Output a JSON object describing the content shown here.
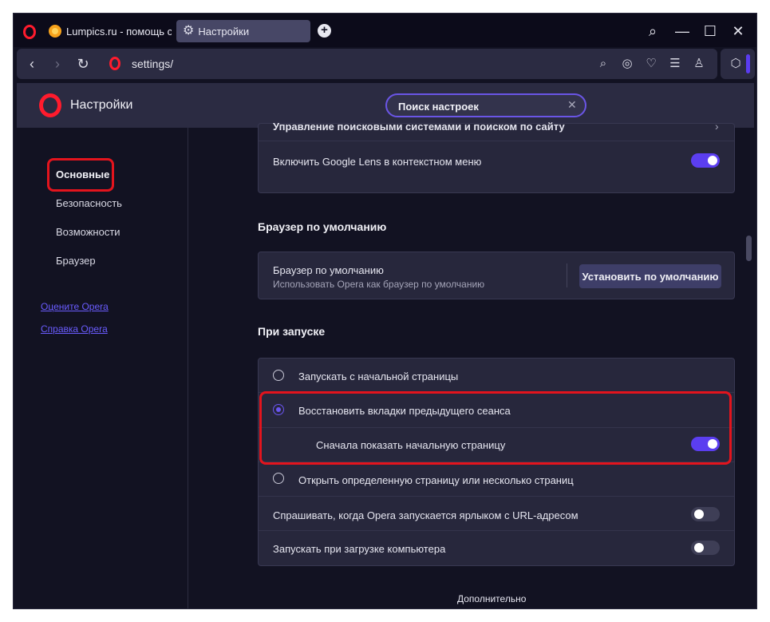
{
  "tabs": [
    {
      "label": "Lumpics.ru - помощь с ко"
    },
    {
      "label": "Настройки"
    }
  ],
  "window_controls": {
    "search": "⌕",
    "minimize": "—",
    "maximize": "☐",
    "close": "✕"
  },
  "address_bar": {
    "url": "settings/"
  },
  "settings_header": {
    "title": "Настройки",
    "search_value": "Поиск настроек"
  },
  "sidebar": {
    "items": [
      {
        "label": "Основные",
        "active": true
      },
      {
        "label": "Безопасность"
      },
      {
        "label": "Возможности"
      },
      {
        "label": "Браузер"
      }
    ],
    "links": [
      {
        "label": "Оцените Opera"
      },
      {
        "label": "Справка Opera"
      }
    ]
  },
  "search_engines": {
    "manage_label": "Управление поисковыми системами и поиском по сайту",
    "google_lens_label": "Включить Google Lens в контекстном меню",
    "google_lens_on": true
  },
  "default_browser": {
    "section_title": "Браузер по умолчанию",
    "row_title": "Браузер по умолчанию",
    "row_subtitle": "Использовать Opera как браузер по умолчанию",
    "button_label": "Установить по умолчанию"
  },
  "startup": {
    "section_title": "При запуске",
    "options": [
      {
        "label": "Запускать с начальной страницы",
        "checked": false
      },
      {
        "label": "Восстановить вкладки предыдущего сеанса",
        "checked": true
      },
      {
        "label": "Открыть определенную страницу или несколько страниц",
        "checked": false
      }
    ],
    "show_start_page_label": "Сначала показать начальную страницу",
    "show_start_page_on": true,
    "ask_url_label": "Спрашивать, когда Opera запускается ярлыком с URL-адресом",
    "ask_url_on": false,
    "launch_on_boot_label": "Запускать при загрузке компьютера",
    "launch_on_boot_on": false
  },
  "footer": {
    "advanced_label": "Дополнительно"
  },
  "colors": {
    "accent": "#5b3ef0",
    "opera_red": "#ff1b2d",
    "highlight_red": "#e3141d",
    "background": "#121222",
    "card": "#27273c",
    "link": "#6a5cff"
  }
}
